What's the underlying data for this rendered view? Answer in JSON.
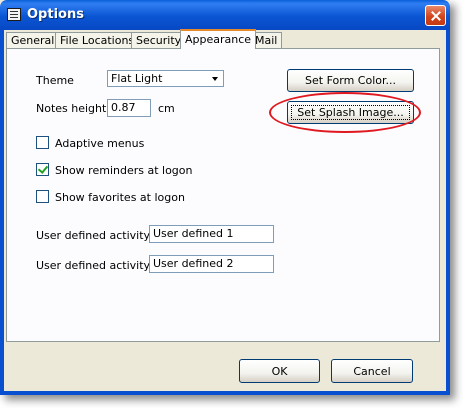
{
  "window": {
    "title": "Options"
  },
  "tabs": [
    {
      "label": "General",
      "active": false
    },
    {
      "label": "File Locations",
      "active": false
    },
    {
      "label": "Security",
      "active": false
    },
    {
      "label": "Appearance",
      "active": true
    },
    {
      "label": "Mail",
      "active": false
    }
  ],
  "appearance": {
    "theme_label": "Theme",
    "theme_value": "Flat Light",
    "notes_height_label": "Notes height:",
    "notes_height_value": "0.87",
    "notes_height_unit": "cm",
    "adaptive_menus": {
      "label": "Adaptive menus",
      "checked": false
    },
    "show_reminders": {
      "label": "Show reminders at logon",
      "checked": true
    },
    "show_favorites": {
      "label": "Show favorites at logon",
      "checked": false
    },
    "user_activity_1": {
      "label": "User defined activity 1",
      "value": "User defined 1"
    },
    "user_activity_2": {
      "label": "User defined activity 2",
      "value": "User defined 2"
    },
    "set_form_color_label": "Set Form Color...",
    "set_splash_image_label": "Set Splash Image..."
  },
  "footer": {
    "ok_label": "OK",
    "cancel_label": "Cancel"
  },
  "colors": {
    "titlebar": "#0a55d2",
    "annotation": "#e0181f",
    "active_tab_accent": "#e68b2c"
  },
  "icons": {
    "title": "form-icon",
    "close": "close-icon",
    "dropdown": "chevron-down-icon"
  }
}
